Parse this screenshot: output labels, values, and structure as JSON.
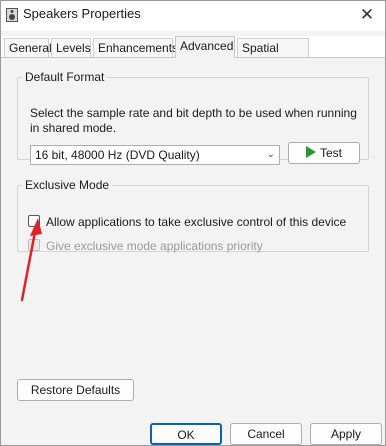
{
  "window": {
    "title": "Speakers Properties",
    "icon": "speaker-icon",
    "close_glyph": "✕"
  },
  "tabs": [
    {
      "label": "General",
      "active": false
    },
    {
      "label": "Levels",
      "active": false
    },
    {
      "label": "Enhancements",
      "active": false
    },
    {
      "label": "Advanced",
      "active": true
    },
    {
      "label": "Spatial sound",
      "active": false
    }
  ],
  "default_format": {
    "legend": "Default Format",
    "description": "Select the sample rate and bit depth to be used when running in shared mode.",
    "selected": "16 bit, 48000 Hz (DVD Quality)",
    "test_label": "Test"
  },
  "exclusive_mode": {
    "legend": "Exclusive Mode",
    "allow_label": "Allow applications to take exclusive control of this device",
    "allow_checked": false,
    "priority_label": "Give exclusive mode applications priority",
    "priority_checked": false,
    "priority_enabled": false
  },
  "restore_label": "Restore Defaults",
  "dialog_buttons": {
    "ok": "OK",
    "cancel": "Cancel",
    "apply": "Apply"
  },
  "colors": {
    "accent": "#0067c0",
    "play_green": "#2a9b2a",
    "annotation_red": "#e0202a"
  }
}
